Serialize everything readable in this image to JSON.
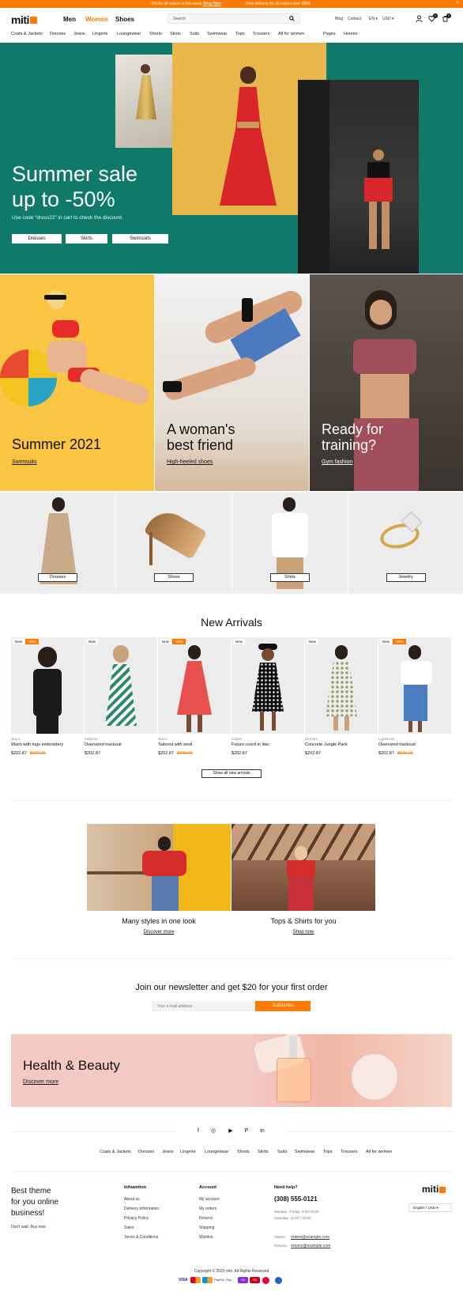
{
  "topbar": {
    "message1": "-2% for all orders in this week",
    "message1_link": "Shop Now",
    "message2": "Free delivery for all orders over $300",
    "close_label": "×"
  },
  "header": {
    "logo": "miti",
    "genders": [
      "Men",
      "Women",
      "Shoes"
    ],
    "active_gender": "Women",
    "search_placeholder": "Search",
    "utility_links": [
      "Blog",
      "Contact"
    ],
    "language": "EN",
    "currency": "USD",
    "wishlist_count": "0",
    "cart_count": "0"
  },
  "nav": {
    "categories": [
      "Coats & Jackets",
      "Dresses",
      "Jeans",
      "Lingerie",
      "Loungewear",
      "Shorts",
      "Skirts",
      "Suits",
      "Swimwear",
      "Tops",
      "Trousers",
      "All for women"
    ],
    "extra": [
      "Pages",
      "Homes"
    ]
  },
  "hero": {
    "title_line1": "Summer sale",
    "title_line2": "up to -50%",
    "code_text": "Use code “dress22” in cart to check the discount.",
    "buttons": [
      "Dresses",
      "Skirts",
      "Swimsuits"
    ]
  },
  "banners": [
    {
      "title": "Summer 2021",
      "link": "Swimsuits"
    },
    {
      "title": "A woman's best friend",
      "link": "High-heeled shoes"
    },
    {
      "title": "Ready for training?",
      "link": "Gym fashion"
    }
  ],
  "categories": [
    "Dresses",
    "Shoes",
    "Shirts",
    "Jewelry"
  ],
  "new_arrivals": {
    "title": "New Arrivals",
    "products": [
      {
        "badge": "New",
        "discount": "-20%",
        "brand": "Gucci",
        "name": "Wash with logo embroidery",
        "price": "$202.87",
        "old_price": "$506.36"
      },
      {
        "badge": "New",
        "discount": "",
        "brand": "Kathens",
        "name": "Oversized tracksuit",
        "price": "$202.87",
        "old_price": ""
      },
      {
        "badge": "New",
        "discount": "-20%",
        "brand": "Gucci",
        "name": "Tailored with wool",
        "price": "$202.87",
        "old_price": "$506.36"
      },
      {
        "badge": "New",
        "discount": "",
        "brand": "Cartier",
        "name": "Future coord in lilac",
        "price": "$202.87",
        "old_price": ""
      },
      {
        "badge": "New",
        "discount": "",
        "brand": "Hermes",
        "name": "Concrete Jungle Pack",
        "price": "$202.87",
        "old_price": ""
      },
      {
        "badge": "New",
        "discount": "-20%",
        "brand": "Lululemon",
        "name": "Oversized tracksuit",
        "price": "$202.87",
        "old_price": "$506.36"
      }
    ],
    "show_all": "Show all new arrivals"
  },
  "promos": [
    {
      "title": "Many styles in one look",
      "link": "Discover more"
    },
    {
      "title": "Tops & Shirts for you",
      "link": "Shop now"
    }
  ],
  "newsletter": {
    "title": "Join our newsletter and get $20 for your first order",
    "placeholder": "Your e-mail address",
    "button": "Subscribe"
  },
  "health": {
    "title": "Health & Beauty",
    "link": "Discover more"
  },
  "social": [
    "f",
    "◎",
    "▶",
    "P",
    "in"
  ],
  "footer_nav": [
    "Coats & Jackets",
    "Dresses",
    "Jeans",
    "Lingerie",
    "Loungewear",
    "Shorts",
    "Skirts",
    "Suits",
    "Swimwear",
    "Tops",
    "Trousers",
    "All for women"
  ],
  "footer": {
    "tagline": [
      "Best theme",
      "for you online",
      "business!"
    ],
    "tagline_sub": "Don't wait. Buy now",
    "information_title": "Infoamtion",
    "information": [
      "About us",
      "Delivery information",
      "Privacy Policy",
      "Sales",
      "Terms & Conditions"
    ],
    "account_title": "Account",
    "account": [
      "My account",
      "My orders",
      "Returns",
      "Shipping",
      "Wishlist"
    ],
    "help_title": "Need help?",
    "phone": "(308) 555-0121",
    "hours1": "Monday - Friday: 9:00-20:00",
    "hours2": "Saturday: 11:00 - 15:00",
    "orders_label": "Orders:",
    "orders_email": "orders@example.com",
    "returns_label": "Returns:",
    "returns_email": "returns@example.com",
    "logo": "miti",
    "lang_currency": "English / USD",
    "copyright": "Copyright © 2020 miti. All Rights Reserved",
    "payments": [
      "VISA",
      "MC",
      "MC",
      "PayPal",
      "Pay",
      "Sk",
      "Sk",
      "●",
      "●"
    ]
  },
  "colors": {
    "accent": "#ff7a00",
    "hero_green": "#0f7a6a"
  }
}
